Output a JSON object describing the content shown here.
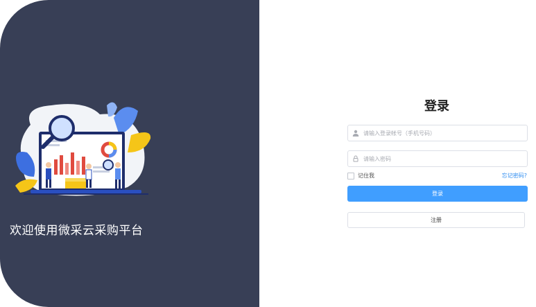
{
  "welcome_text": "欢迎使用微采云采购平台",
  "login": {
    "title": "登录",
    "account_placeholder": "请输入登录帐号（手机号码）",
    "password_placeholder": "请输入密码",
    "remember_label": "记住我",
    "forgot_label": "忘记密码?",
    "login_button": "登录",
    "register_button": "注册"
  },
  "icons": {
    "account": "user-icon",
    "password": "lock-icon",
    "illustration": "data-analysis-illustration"
  },
  "colors": {
    "left_panel": "#383f56",
    "primary": "#409eff",
    "link": "#2d8cf0"
  }
}
